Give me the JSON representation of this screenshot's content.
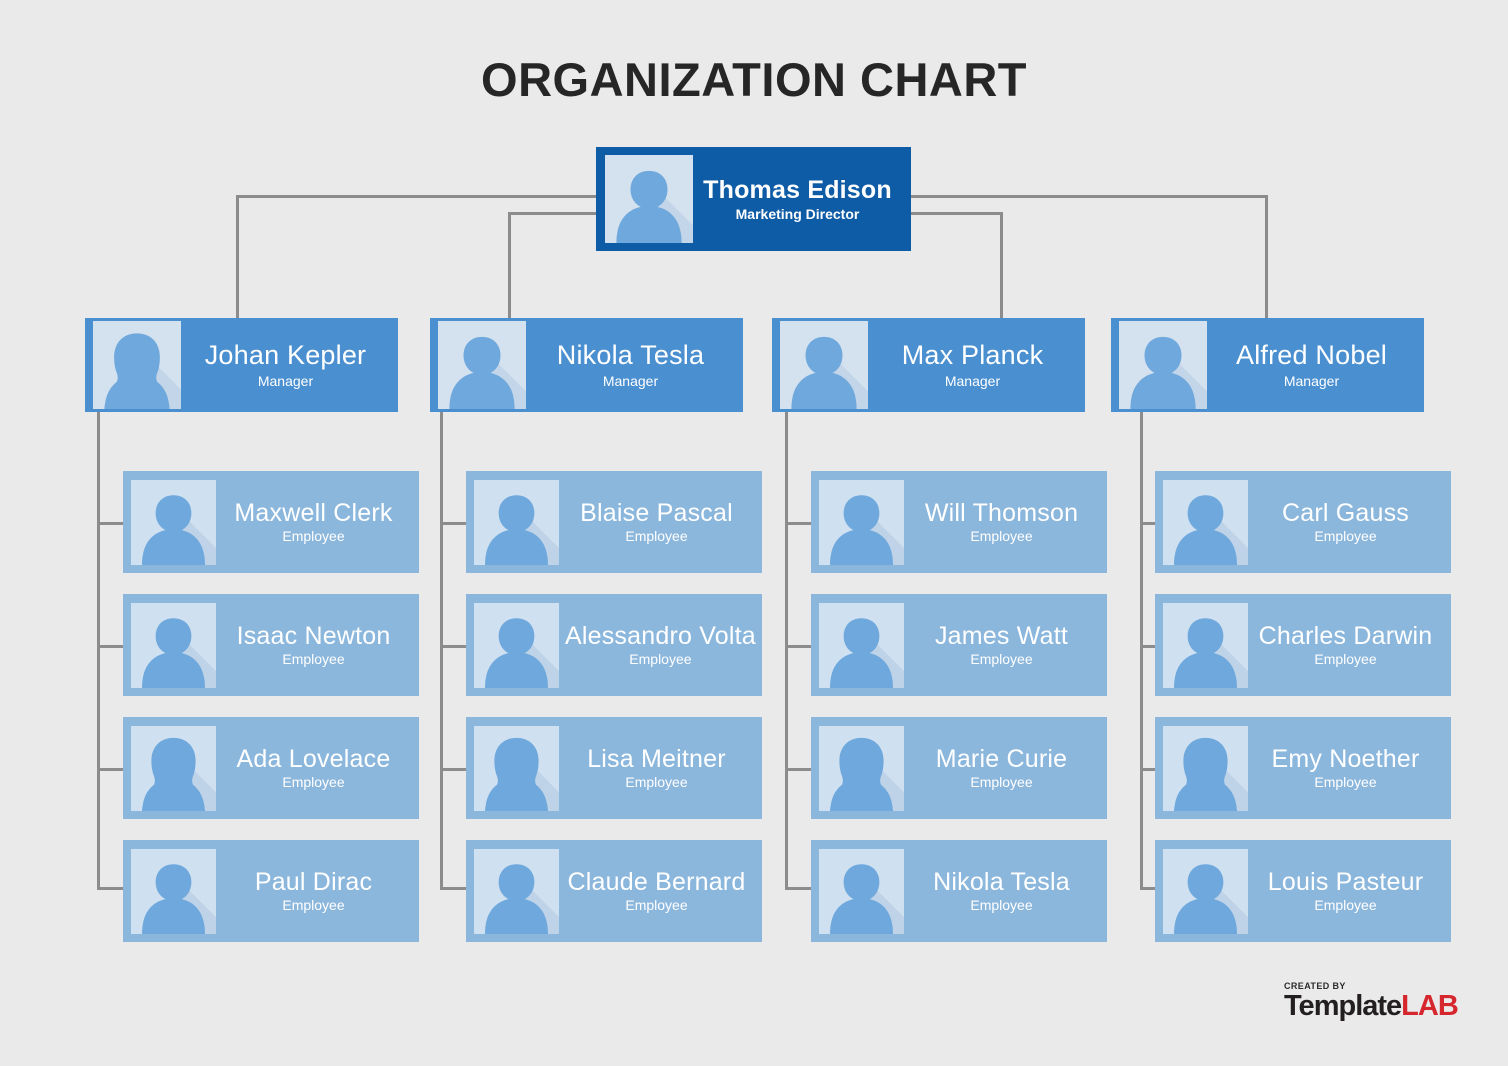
{
  "title": "ORGANIZATION CHART",
  "colors": {
    "background": "#eaeaea",
    "root_box": "#0e5ca6",
    "manager_box": "#4a8fd0",
    "employee_box": "#8cb7dd",
    "avatar_bg": "#d4e1ef",
    "avatar_silhouette": "#6fa8dc",
    "connector_line": "#8c8c8c",
    "title_text": "#262626",
    "node_text": "#ffffff",
    "logo_dark": "#231f20",
    "logo_red": "#d7272e"
  },
  "root": {
    "name": "Thomas Edison",
    "role": "Marketing Director",
    "avatar": "avatar-male-icon"
  },
  "columns": [
    {
      "manager": {
        "name": "Johan Kepler",
        "role": "Manager",
        "avatar": "avatar-female-icon"
      },
      "employees": [
        {
          "name": "Maxwell Clerk",
          "role": "Employee",
          "avatar": "avatar-male-icon"
        },
        {
          "name": "Isaac Newton",
          "role": "Employee",
          "avatar": "avatar-male-icon"
        },
        {
          "name": "Ada Lovelace",
          "role": "Employee",
          "avatar": "avatar-female-icon"
        },
        {
          "name": "Paul Dirac",
          "role": "Employee",
          "avatar": "avatar-male-icon"
        }
      ]
    },
    {
      "manager": {
        "name": "Nikola Tesla",
        "role": "Manager",
        "avatar": "avatar-male-icon"
      },
      "employees": [
        {
          "name": "Blaise Pascal",
          "role": "Employee",
          "avatar": "avatar-male-icon"
        },
        {
          "name": "Alessandro Volta",
          "role": "Employee",
          "avatar": "avatar-male-icon"
        },
        {
          "name": "Lisa Meitner",
          "role": "Employee",
          "avatar": "avatar-female-icon"
        },
        {
          "name": "Claude Bernard",
          "role": "Employee",
          "avatar": "avatar-male-icon"
        }
      ]
    },
    {
      "manager": {
        "name": "Max Planck",
        "role": "Manager",
        "avatar": "avatar-male-icon"
      },
      "employees": [
        {
          "name": "Will Thomson",
          "role": "Employee",
          "avatar": "avatar-male-icon"
        },
        {
          "name": "James Watt",
          "role": "Employee",
          "avatar": "avatar-male-icon"
        },
        {
          "name": "Marie Curie",
          "role": "Employee",
          "avatar": "avatar-female-icon"
        },
        {
          "name": "Nikola Tesla",
          "role": "Employee",
          "avatar": "avatar-male-icon"
        }
      ]
    },
    {
      "manager": {
        "name": "Alfred Nobel",
        "role": "Manager",
        "avatar": "avatar-male-icon"
      },
      "employees": [
        {
          "name": "Carl Gauss",
          "role": "Employee",
          "avatar": "avatar-male-icon"
        },
        {
          "name": "Charles Darwin",
          "role": "Employee",
          "avatar": "avatar-male-icon"
        },
        {
          "name": "Emy Noether",
          "role": "Employee",
          "avatar": "avatar-female-icon"
        },
        {
          "name": "Louis Pasteur",
          "role": "Employee",
          "avatar": "avatar-male-icon"
        }
      ]
    }
  ],
  "logo": {
    "created_by": "CREATED BY",
    "word_dark": "Template",
    "word_red": "LAB"
  }
}
